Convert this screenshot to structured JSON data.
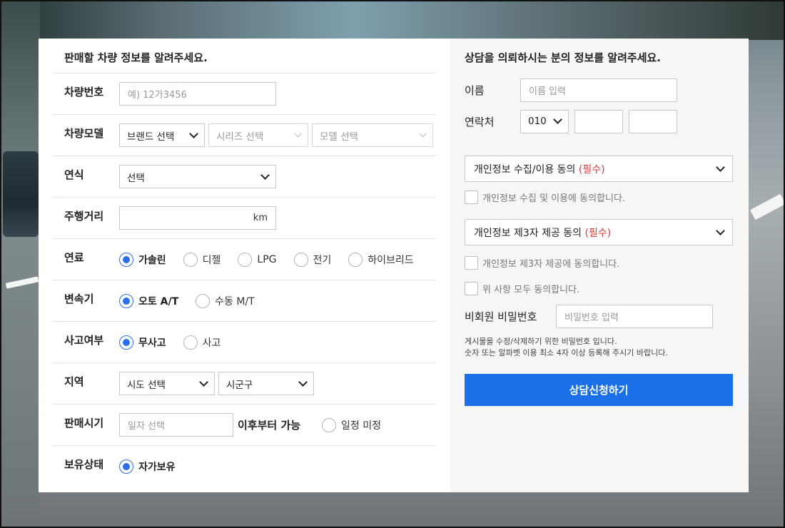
{
  "colors": {
    "accent": "#1b6fe8",
    "required": "#d63a3a",
    "panel_bg": "#f6f6f6"
  },
  "left": {
    "title": "판매할 차량 정보를 알려주세요.",
    "plate": {
      "label": "차량번호",
      "placeholder": "예) 12가3456"
    },
    "model": {
      "label": "차량모델",
      "brand": "브랜드 선택",
      "series": "시리즈 선택",
      "model": "모델 선택"
    },
    "year": {
      "label": "연식",
      "value": "선택"
    },
    "mileage": {
      "label": "주행거리",
      "unit": "km"
    },
    "fuel": {
      "label": "연료",
      "options": [
        "가솔린",
        "디젤",
        "LPG",
        "전기",
        "하이브리드"
      ],
      "selected": "가솔린"
    },
    "transmission": {
      "label": "변속기",
      "options": [
        "오토 A/T",
        "수동 M/T"
      ],
      "selected": "오토 A/T"
    },
    "accident": {
      "label": "사고여부",
      "options": [
        "무사고",
        "사고"
      ],
      "selected": "무사고"
    },
    "region": {
      "label": "지역",
      "city": "시도 선택",
      "district": "시군구"
    },
    "sale_time": {
      "label": "판매시기",
      "placeholder": "일자 선택",
      "after": "이후부터 가능",
      "undecided": "일정 미정"
    },
    "ownership": {
      "label": "보유상태",
      "option": "자가보유"
    }
  },
  "right": {
    "title": "상담을 의뢰하시는 분의 정보를 알려주세요.",
    "name": {
      "label": "이름",
      "placeholder": "이름 입력"
    },
    "phone": {
      "label": "연락처",
      "prefix": "010"
    },
    "privacy_collect": {
      "title": "개인정보 수집/이용 동의",
      "required": "(필수)",
      "checkbox": "개인정보 수집 및 이용에 동의합니다."
    },
    "privacy_third": {
      "title": "개인정보 제3자 제공 동의",
      "required": "(필수)",
      "checkbox": "개인정보 제3자 제공에 동의합니다."
    },
    "agree_all": "위 사항 모두 동의합니다.",
    "password": {
      "label": "비회원 비밀번호",
      "placeholder": "비밀번호 입력"
    },
    "note_1": "게시물을 수정/삭제하기 위한 비밀번호 입니다.",
    "note_2": "숫자 또는 알파벳 이용 최소 4자 이상 등록해 주시기 바랍니다.",
    "submit": "상담신청하기"
  }
}
